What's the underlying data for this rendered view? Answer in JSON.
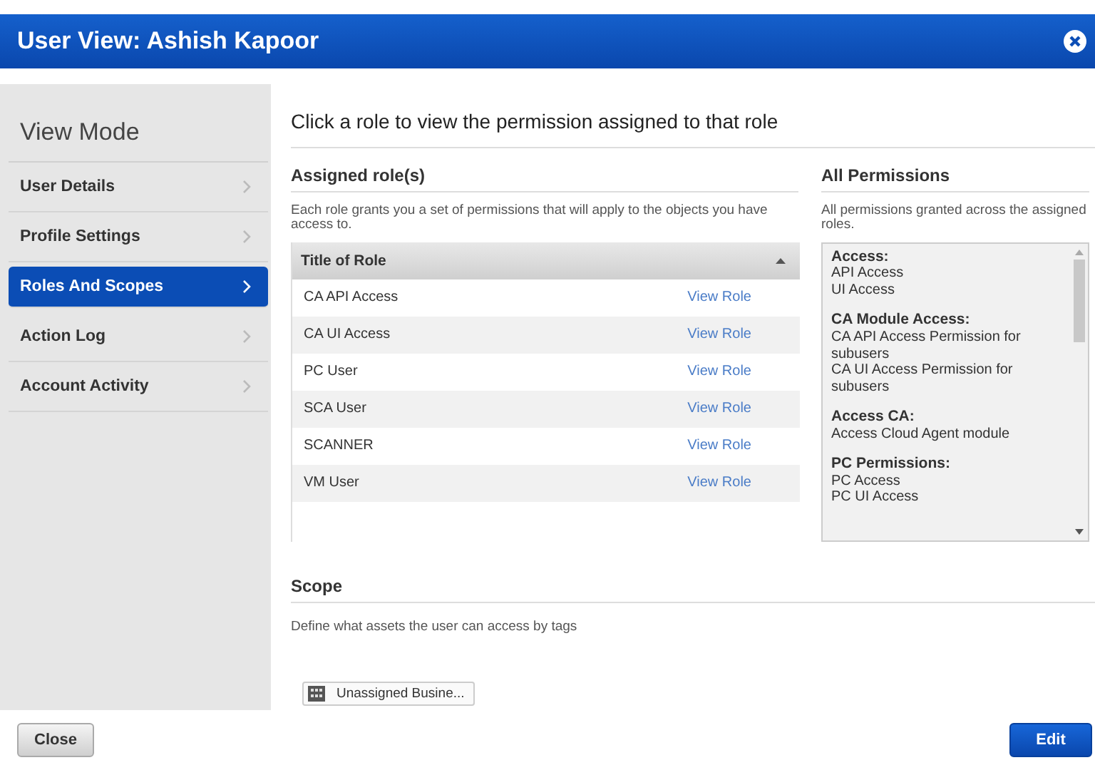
{
  "window": {
    "title": "User View: Ashish Kapoor"
  },
  "sidebar": {
    "title": "View Mode",
    "items": [
      {
        "label": "User Details",
        "selected": false
      },
      {
        "label": "Profile Settings",
        "selected": false
      },
      {
        "label": "Roles And Scopes",
        "selected": true
      },
      {
        "label": "Action Log",
        "selected": false
      },
      {
        "label": "Account Activity",
        "selected": false
      }
    ]
  },
  "heading": "Click a role to view the permission assigned to that role",
  "assigned_roles": {
    "title": "Assigned role(s)",
    "description": "Each role grants you a set of permissions that will apply to the objects you have access to.",
    "column": "Title of Role",
    "rows": [
      {
        "name": "CA API Access",
        "action": "View Role"
      },
      {
        "name": "CA UI Access",
        "action": "View Role"
      },
      {
        "name": "PC User",
        "action": "View Role"
      },
      {
        "name": "SCA User",
        "action": "View Role"
      },
      {
        "name": "SCANNER",
        "action": "View Role"
      },
      {
        "name": "VM User",
        "action": "View Role"
      }
    ]
  },
  "all_permissions": {
    "title": "All Permissions",
    "description": "All permissions granted across the assigned roles.",
    "groups": [
      {
        "name": "Access:",
        "items": [
          "API Access",
          "UI Access"
        ]
      },
      {
        "name": "CA Module Access:",
        "items": [
          "CA API Access Permission for subusers",
          "CA UI Access Permission for subusers"
        ]
      },
      {
        "name": "Access CA:",
        "items": [
          "Access Cloud Agent module"
        ]
      },
      {
        "name": "PC Permissions:",
        "items": [
          "PC Access",
          "PC UI Access"
        ]
      }
    ]
  },
  "scope": {
    "title": "Scope",
    "description": "Define what assets the user can access by tags",
    "tag": "Unassigned Busine..."
  },
  "buttons": {
    "close": "Close",
    "edit": "Edit"
  }
}
